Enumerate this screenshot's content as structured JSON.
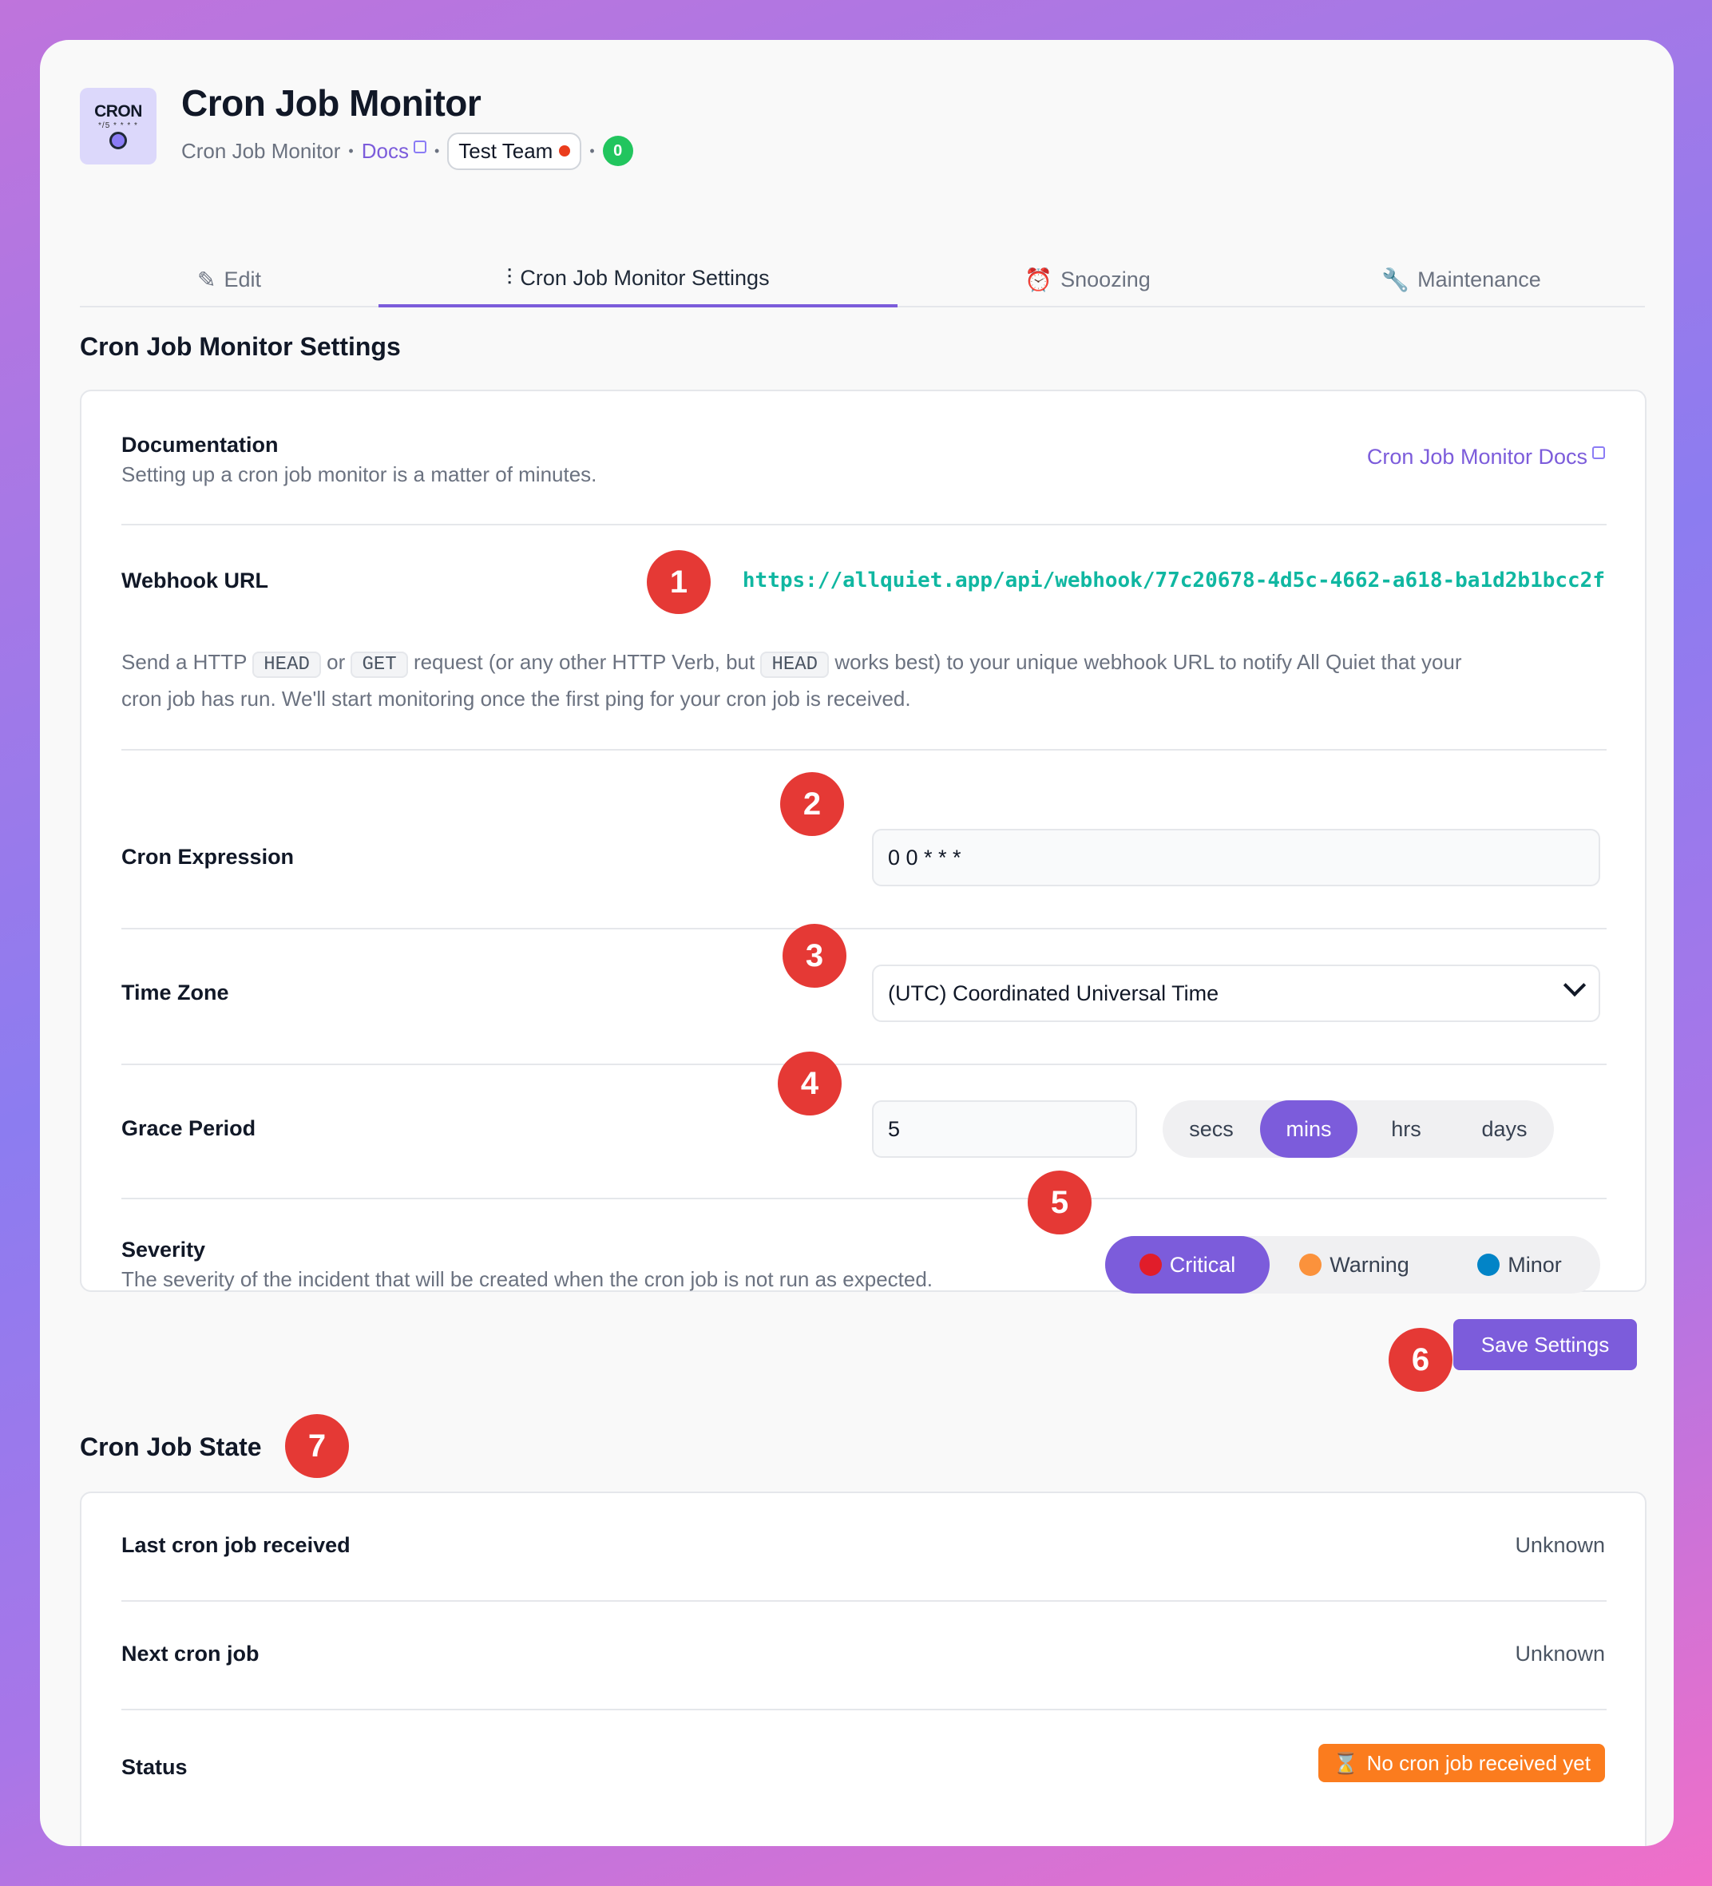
{
  "header": {
    "logo_top": "CRON",
    "logo_sub": "*/5 * * * *",
    "title": "Cron Job Monitor",
    "integration_name": "Cron Job Monitor",
    "docs_label": "Docs",
    "team_label": "Test Team",
    "count": "0"
  },
  "tabs": [
    {
      "label": "Edit",
      "icon": "pencil-icon"
    },
    {
      "label": "Cron Job Monitor Settings",
      "icon": "sliders-icon"
    },
    {
      "label": "Snoozing",
      "icon": "alarm-off-icon"
    },
    {
      "label": "Maintenance",
      "icon": "wrench-icon"
    }
  ],
  "settings": {
    "section_title": "Cron Job Monitor Settings",
    "documentation": {
      "label": "Documentation",
      "description": "Setting up a cron job monitor is a matter of minutes.",
      "link": "Cron Job Monitor Docs"
    },
    "webhook": {
      "label": "Webhook URL",
      "url": "https://allquiet.app/api/webhook/77c20678-4d5c-4662-a618-ba1d2b1bcc2f",
      "help_1": "Send a HTTP",
      "code_head": "HEAD",
      "help_or": "or",
      "code_get": "GET",
      "help_2": "request (or any other HTTP Verb, but",
      "help_3": "works best) to your unique webhook URL to notify All Quiet that your",
      "help_4": "cron job has run. We'll start monitoring once the first ping for your cron job is received."
    },
    "cron_expression": {
      "label": "Cron Expression",
      "value": "0 0 * * *"
    },
    "time_zone": {
      "label": "Time Zone",
      "value": "(UTC) Coordinated Universal Time"
    },
    "grace_period": {
      "label": "Grace Period",
      "value": "5",
      "units": [
        "secs",
        "mins",
        "hrs",
        "days"
      ],
      "selected_unit": "mins"
    },
    "severity": {
      "label": "Severity",
      "description": "The severity of the incident that will be created when the cron job is not run as expected.",
      "options": [
        {
          "label": "Critical",
          "color": "#e11d2a"
        },
        {
          "label": "Warning",
          "color": "#fb923c"
        },
        {
          "label": "Minor",
          "color": "#0284c7"
        }
      ],
      "selected": "Critical"
    },
    "save_label": "Save Settings"
  },
  "state": {
    "section_title": "Cron Job State",
    "last_label": "Last cron job received",
    "last_value": "Unknown",
    "next_label": "Next cron job",
    "next_value": "Unknown",
    "status_label": "Status",
    "status_value": "No cron job received yet"
  },
  "badges": [
    "1",
    "2",
    "3",
    "4",
    "5",
    "6",
    "7"
  ],
  "colors": {
    "accent": "#7c5cdb",
    "badge": "#e53935",
    "webhook": "#10b7a1",
    "status": "#fb7c1e"
  }
}
